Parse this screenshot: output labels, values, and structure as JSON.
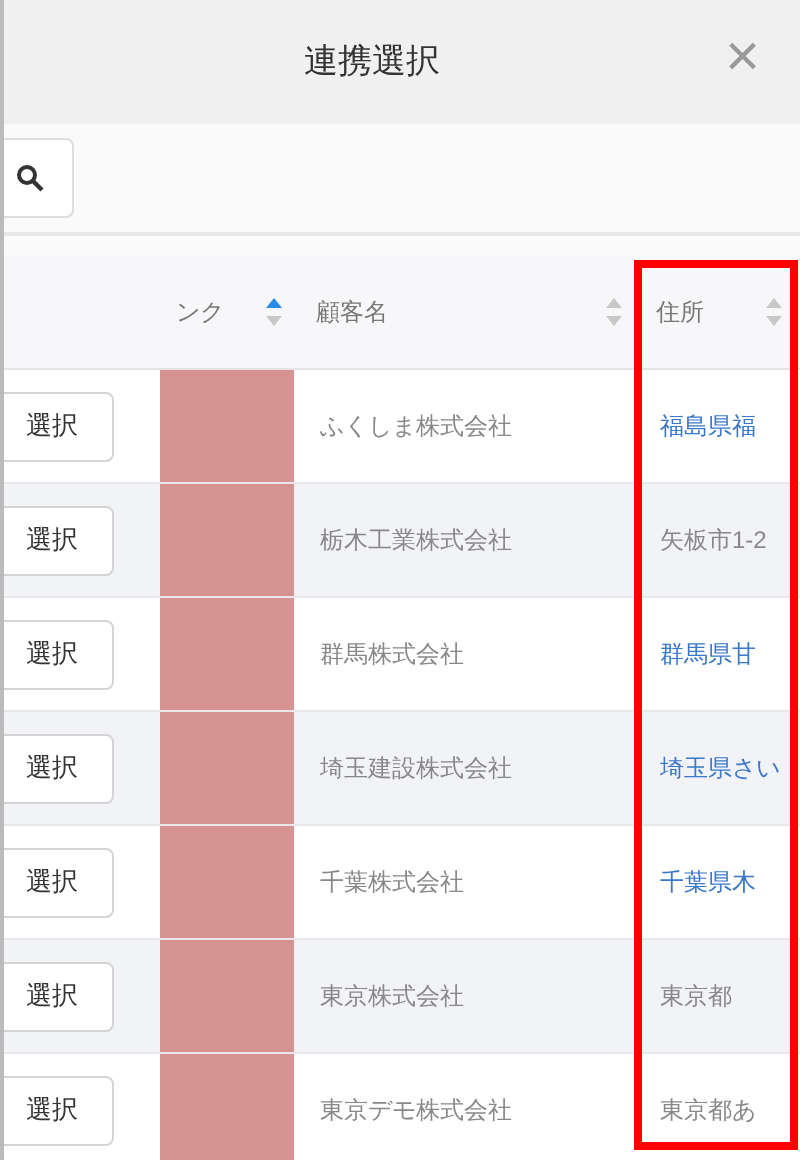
{
  "dialog": {
    "title": "連携選択",
    "close": "×"
  },
  "columns": [
    {
      "label": "ンク",
      "sorted_ascending": true
    },
    {
      "label": "顧客名",
      "sorted_ascending": false
    },
    {
      "label": "住所",
      "sorted_ascending": false
    }
  ],
  "highlight_frame": true,
  "rows": [
    {
      "button": "選択",
      "redacted": true,
      "name": "ふくしま株式会社",
      "address": "福島県福",
      "address_link": true
    },
    {
      "button": "選択",
      "redacted": true,
      "name": "栃木工業株式会社",
      "address": "矢板市1-2",
      "address_link": false
    },
    {
      "button": "選択",
      "redacted": true,
      "name": "群馬株式会社",
      "address": "群馬県甘",
      "address_link": true
    },
    {
      "button": "選択",
      "redacted": true,
      "name": "埼玉建設株式会社",
      "address": "埼玉県さい",
      "address_link": true
    },
    {
      "button": "選択",
      "redacted": true,
      "name": "千葉株式会社",
      "address": "千葉県木",
      "address_link": true
    },
    {
      "button": "選択",
      "redacted": true,
      "name": "東京株式会社",
      "address": "東京都",
      "address_link": false
    },
    {
      "button": "選択",
      "redacted": true,
      "name": "東京デモ株式会社",
      "address": "東京都あ",
      "address_link": false
    }
  ]
}
